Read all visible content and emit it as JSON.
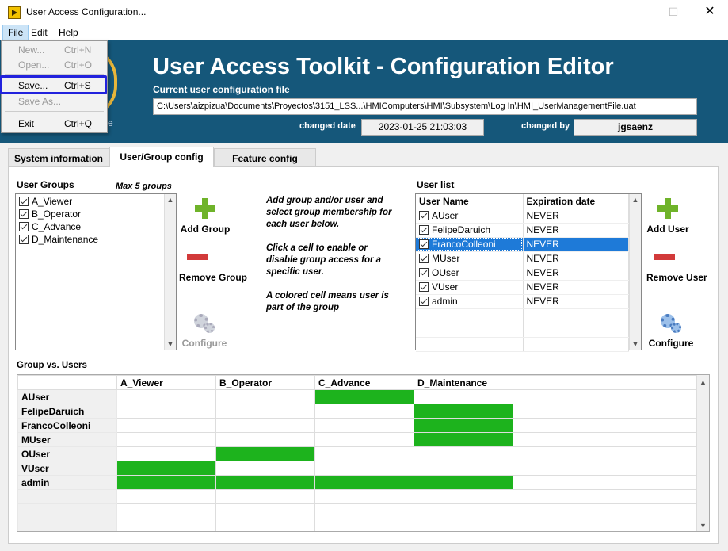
{
  "window": {
    "title": "User Access Configuration...",
    "min": "—",
    "max": "☐",
    "close": "✕"
  },
  "menubar": {
    "file": "File",
    "edit": "Edit",
    "help": "Help"
  },
  "file_menu": [
    {
      "label": "New...",
      "shortcut": "Ctrl+N",
      "enabled": false
    },
    {
      "label": "Open...",
      "shortcut": "Ctrl+O",
      "enabled": false
    },
    {
      "label": "Save...",
      "shortcut": "Ctrl+S",
      "enabled": true
    },
    {
      "label": "Save As...",
      "shortcut": "",
      "enabled": false
    },
    {
      "label": "Exit",
      "shortcut": "Ctrl+Q",
      "enabled": true
    }
  ],
  "banner": {
    "title": "User Access Toolkit - Configuration Editor",
    "logo_suffix": "e",
    "config_label": "Current user configuration file",
    "config_path": "C:\\Users\\aizpizua\\Documents\\Proyectos\\3151_LSS...\\HMIComputers\\HMI\\Subsystem\\Log In\\HMI_UserManagementFile.uat",
    "changed_date_label": "changed date",
    "changed_date": "2023-01-25 21:03:03",
    "changed_by_label": "changed by",
    "changed_by": "jgsaenz"
  },
  "tabs": {
    "sysinfo": "System information",
    "usergroup": "User/Group config",
    "feature": "Feature config"
  },
  "user_groups": {
    "label": "User Groups",
    "max_note": "Max 5 groups",
    "items": [
      "A_Viewer",
      "B_Operator",
      "C_Advance",
      "D_Maintenance"
    ]
  },
  "group_buttons": {
    "add": "Add Group",
    "remove": "Remove Group",
    "configure": "Configure"
  },
  "instructions": {
    "p1": "Add group and/or user and select group membership for each user below.",
    "p2": "Click a cell to enable or disable group access for a specific user.",
    "p3": "A colored cell means user is part of the group"
  },
  "user_list": {
    "label": "User list",
    "col_name": "User Name",
    "col_exp": "Expiration date",
    "rows": [
      {
        "name": "AUser",
        "exp": "NEVER"
      },
      {
        "name": "FelipeDaruich",
        "exp": "NEVER"
      },
      {
        "name": "FrancoColleoni",
        "exp": "NEVER"
      },
      {
        "name": "MUser",
        "exp": "NEVER"
      },
      {
        "name": "OUser",
        "exp": "NEVER"
      },
      {
        "name": "VUser",
        "exp": "NEVER"
      },
      {
        "name": "admin",
        "exp": "NEVER"
      }
    ],
    "selected": "FrancoColleoni"
  },
  "user_buttons": {
    "add": "Add User",
    "remove": "Remove User",
    "configure": "Configure"
  },
  "matrix": {
    "label": "Group vs. Users",
    "columns": [
      "A_Viewer",
      "B_Operator",
      "C_Advance",
      "D_Maintenance"
    ],
    "rows": [
      {
        "user": "AUser",
        "groups": [
          0,
          0,
          1,
          0
        ]
      },
      {
        "user": "FelipeDaruich",
        "groups": [
          0,
          0,
          0,
          1
        ]
      },
      {
        "user": "FrancoColleoni",
        "groups": [
          0,
          0,
          0,
          1
        ]
      },
      {
        "user": "MUser",
        "groups": [
          0,
          0,
          0,
          1
        ]
      },
      {
        "user": "OUser",
        "groups": [
          0,
          1,
          0,
          0
        ]
      },
      {
        "user": "VUser",
        "groups": [
          1,
          0,
          0,
          0
        ]
      },
      {
        "user": "admin",
        "groups": [
          1,
          1,
          1,
          1
        ]
      }
    ],
    "on_color": "#1db31d"
  },
  "colors": {
    "banner": "#15577a",
    "selection": "#1e7ad8",
    "highlight": "#2222dd"
  },
  "scroll": {
    "up": "▲",
    "down": "▼"
  }
}
